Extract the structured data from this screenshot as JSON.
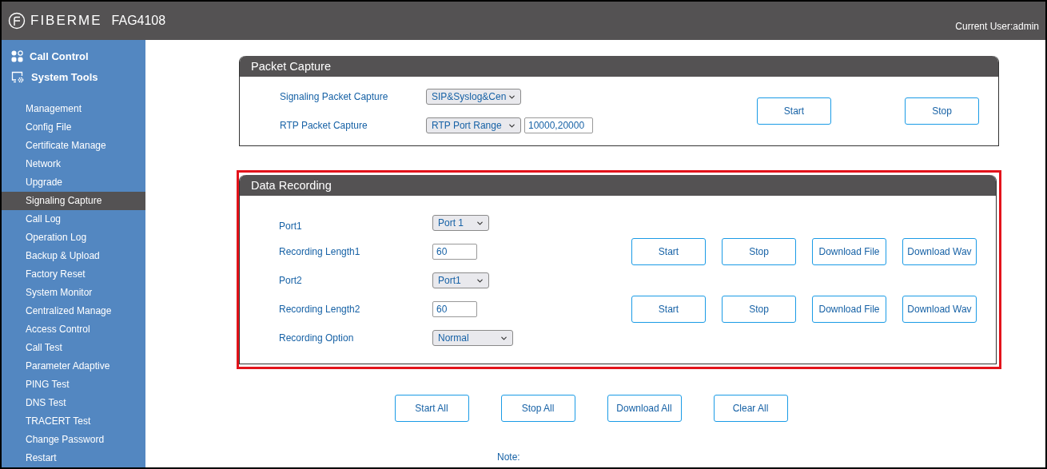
{
  "header": {
    "brand": "FIBERME",
    "model": "FAG4108",
    "user": "Current User:admin"
  },
  "sidebar": {
    "groups": [
      {
        "label": "Call Control",
        "kind": "apps"
      },
      {
        "label": "System Tools",
        "kind": "monitor"
      }
    ],
    "items": [
      {
        "label": "Management",
        "selected": false
      },
      {
        "label": "Config File",
        "selected": false
      },
      {
        "label": "Certificate Manage",
        "selected": false
      },
      {
        "label": "Network",
        "selected": false
      },
      {
        "label": "Upgrade",
        "selected": false
      },
      {
        "label": "Signaling Capture",
        "selected": true
      },
      {
        "label": "Call Log",
        "selected": false
      },
      {
        "label": "Operation Log",
        "selected": false
      },
      {
        "label": "Backup & Upload",
        "selected": false
      },
      {
        "label": "Factory Reset",
        "selected": false
      },
      {
        "label": "System Monitor",
        "selected": false
      },
      {
        "label": "Centralized Manage",
        "selected": false
      },
      {
        "label": "Access Control",
        "selected": false
      },
      {
        "label": "Call Test",
        "selected": false
      },
      {
        "label": "Parameter Adaptive",
        "selected": false
      },
      {
        "label": "PING Test",
        "selected": false
      },
      {
        "label": "DNS Test",
        "selected": false
      },
      {
        "label": "TRACERT Test",
        "selected": false
      },
      {
        "label": "Change Password",
        "selected": false
      },
      {
        "label": "Restart",
        "selected": false
      }
    ]
  },
  "packet_capture": {
    "title": "Packet Capture",
    "rows": [
      {
        "label": "Signaling Packet Capture",
        "select": "SIP&Syslog&Cen"
      },
      {
        "label": "RTP Packet Capture",
        "select": "RTP Port Range",
        "input": "10000,20000"
      }
    ],
    "buttons": [
      "Start",
      "Stop"
    ]
  },
  "data_recording": {
    "title": "Data Recording",
    "highlighted": true,
    "rows": [
      {
        "label": "Port1",
        "kind": "select",
        "value": "Port 1"
      },
      {
        "label": "Recording Length1",
        "kind": "input",
        "value": "60",
        "buttons": [
          "Start",
          "Stop",
          "Download File",
          "Download Wav"
        ]
      },
      {
        "label": "Port2",
        "kind": "select",
        "value": "Port1"
      },
      {
        "label": "Recording Length2",
        "kind": "input",
        "value": "60",
        "buttons": [
          "Start",
          "Stop",
          "Download File",
          "Download Wav"
        ]
      },
      {
        "label": "Recording Option",
        "kind": "wide_select",
        "value": "Normal"
      }
    ]
  },
  "actions": [
    "Start All",
    "Stop All",
    "Download All",
    "Clear All"
  ],
  "note": "Note:"
}
